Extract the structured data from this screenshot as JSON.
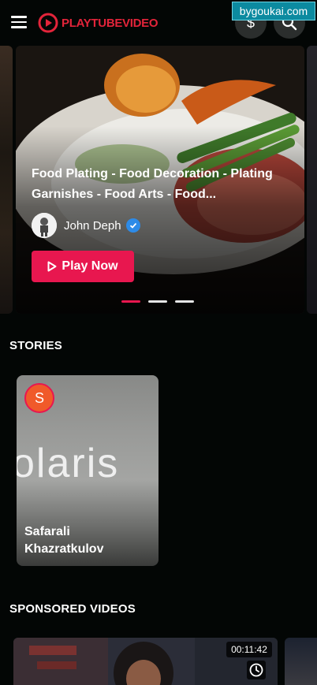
{
  "header": {
    "logo_text": "PLAYTUBEVIDEO",
    "menu_icon": "hamburger-icon",
    "wallet_label": "$",
    "search_icon": "search-icon"
  },
  "watermark": "bygoukai.com",
  "hero": {
    "title": "Food Plating - Food Decoration - Plating Garnishes - Food Arts - Food...",
    "author": "John Deph",
    "play_label": "Play Now"
  },
  "stories": {
    "title": "STORIES",
    "items": [
      {
        "avatar_letter": "S",
        "name": "Safarali Khazratkulov",
        "thumb_text": "olaris"
      }
    ]
  },
  "sponsored": {
    "title": "SPONSORED VIDEOS",
    "items": [
      {
        "duration": "00:11:42"
      }
    ]
  },
  "colors": {
    "accent": "#e8174f",
    "background": "#030605",
    "verified": "#2d8be8"
  }
}
